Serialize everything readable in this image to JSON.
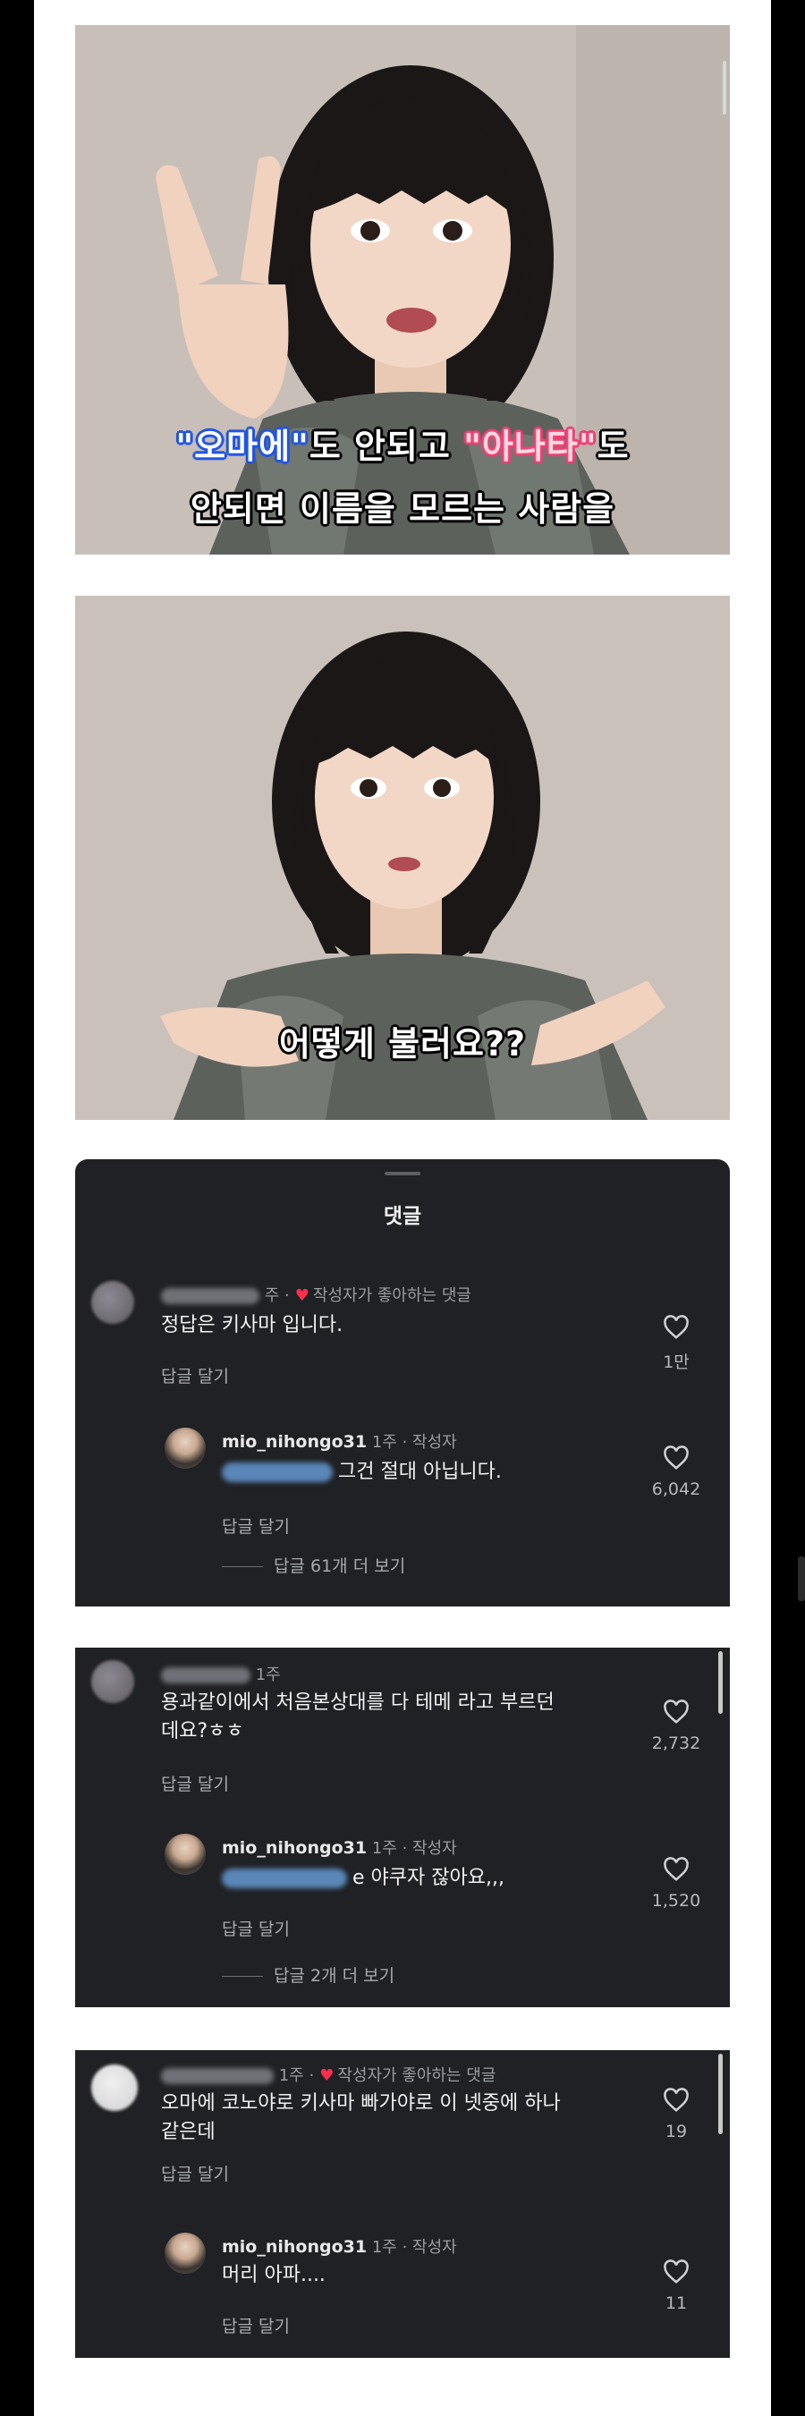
{
  "video": {
    "frame1_subtitle_line1": {
      "q1": "\"오마에\"",
      "mid": "도 안되고 ",
      "q2": "\"아나타\"",
      "end": "도"
    },
    "frame1_subtitle_line2": "안되면 이름을 모르는 사람을",
    "frame2_subtitle": "어떻게 불러요??"
  },
  "comments_sheet": {
    "title": "댓글",
    "threads": [
      {
        "time": "주 ·",
        "creator_liked_label": "작성자가 좋아하는 댓글",
        "text": "정답은 키사마 입니다.",
        "reply_label": "답글 달기",
        "likes": "1만",
        "reply": {
          "username": "mio_nihongo31",
          "meta": "1주 · 작성자",
          "text": "그건 절대 아닙니다.",
          "reply_label": "답글 달기",
          "likes": "6,042"
        },
        "more_replies": "답글 61개 더 보기"
      },
      {
        "time": "1주",
        "text_line1": "용과같이에서 처음본상대를 다 테메 라고 부르던",
        "text_line2": "데요?ㅎㅎ",
        "reply_label": "답글 달기",
        "likes": "2,732",
        "reply": {
          "username": "mio_nihongo31",
          "meta": "1주 · 작성자",
          "text_suffix": "e 야쿠자 잖아요,,,",
          "reply_label": "답글 달기",
          "likes": "1,520"
        },
        "more_replies": "답글 2개 더 보기"
      },
      {
        "time": "1주 ·",
        "creator_liked_label": "작성자가 좋아하는 댓글",
        "text_line1": "오마에 코노야로 키사마 빠가야로 이 넷중에 하나",
        "text_line2": "같은데",
        "reply_label": "답글 달기",
        "likes": "19",
        "reply": {
          "username": "mio_nihongo31",
          "meta": "1주 · 작성자",
          "text": "머리 아파....",
          "reply_label": "답글 달기",
          "likes": "11"
        }
      }
    ]
  },
  "colors": {
    "panel_bg": "#1f2124",
    "creator_heart": "#ff2e4d",
    "subtitle_blue": "#2453d8",
    "subtitle_pink": "#e63d6f"
  }
}
